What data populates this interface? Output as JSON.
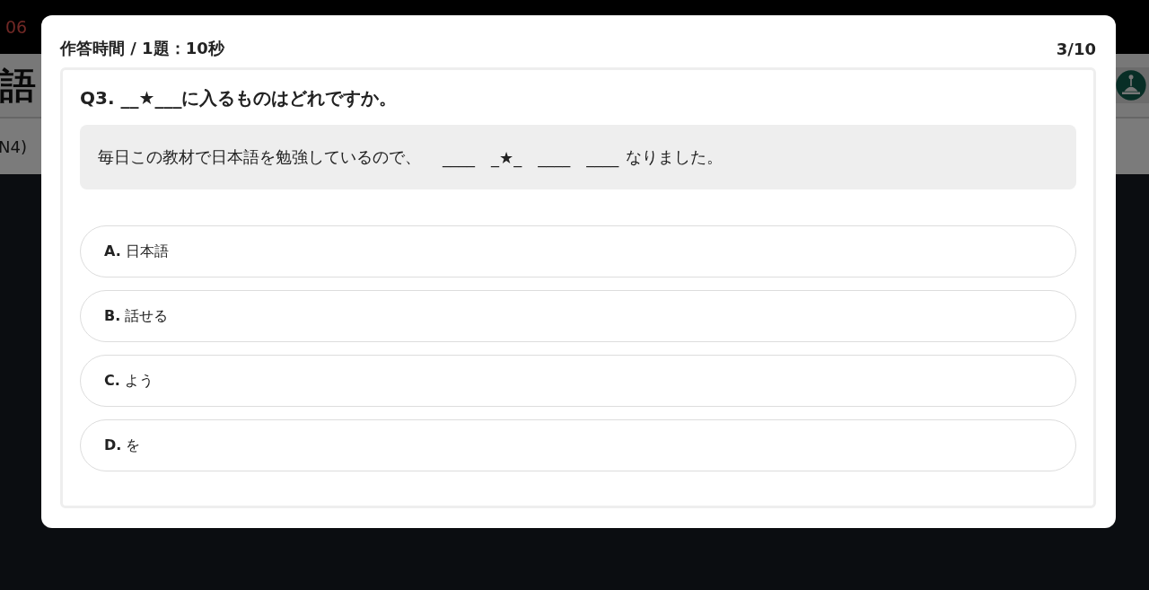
{
  "background": {
    "top_number": "06",
    "heading": "語",
    "level_text": "N4)"
  },
  "modal": {
    "timer": "作答時間 / 1題：10秒",
    "progress": "3/10",
    "question": {
      "title": "Q3. __★___に入るものはどれですか。",
      "sentence": {
        "before": "毎日この教材で日本語を勉強しているので、",
        "blanks": [
          "____",
          "_★_",
          "____",
          "____"
        ],
        "after": "なりました。"
      },
      "options": [
        {
          "letter": "A.",
          "text": "日本語"
        },
        {
          "letter": "B.",
          "text": "話せる"
        },
        {
          "letter": "C.",
          "text": "よう"
        },
        {
          "letter": "D.",
          "text": "を"
        }
      ]
    }
  }
}
